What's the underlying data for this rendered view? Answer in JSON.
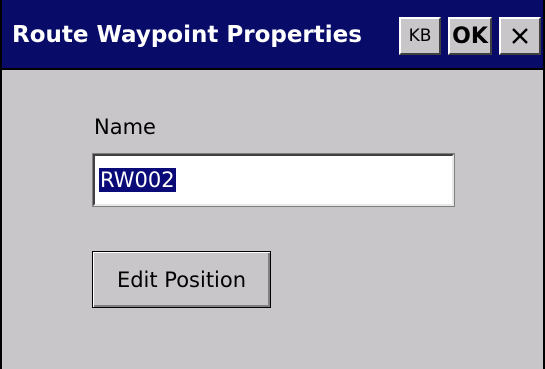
{
  "dialog": {
    "title": "Route Waypoint Properties",
    "buttons": {
      "kb_label": "KB",
      "ok_label": "OK",
      "close_icon": "close-x"
    }
  },
  "form": {
    "name_label": "Name",
    "name_value": "RW002",
    "name_selected": true,
    "edit_position_label": "Edit Position"
  },
  "colors": {
    "titlebar": "#080c68",
    "window_background": "#c8c6c8",
    "selection_highlight": "#0a0a78"
  }
}
